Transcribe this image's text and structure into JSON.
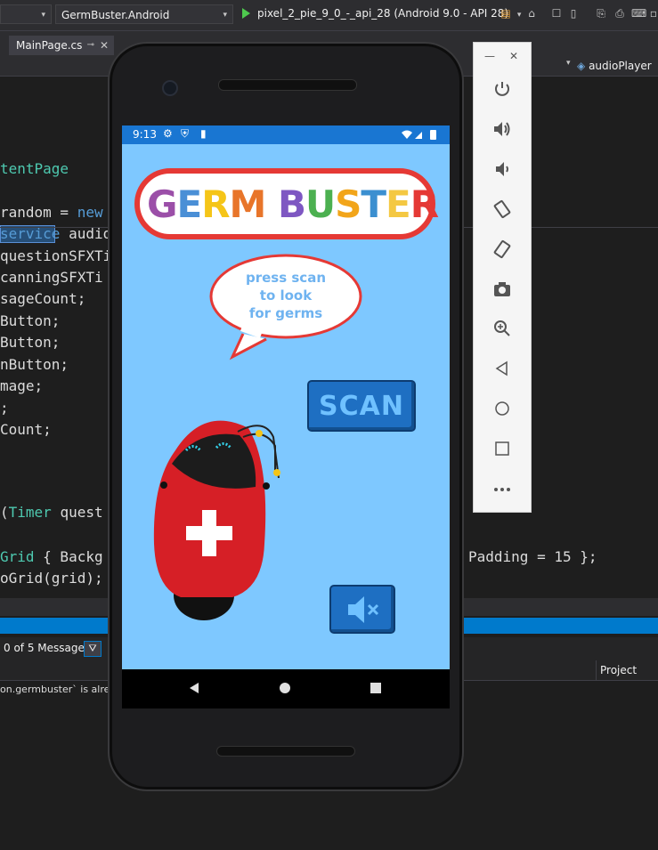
{
  "toolbar": {
    "config_arrow": "▾",
    "project_combo": "GermBuster.Android",
    "run_target": "pixel_2_pie_9_0_-_api_28 (Android 9.0 - API 28)",
    "run_arrow": "▾"
  },
  "editor": {
    "tab_label": "MainPage.cs",
    "tab_pin": "⊸",
    "tab_close": "✕",
    "member_combo": "audioPlayer",
    "code_lines": [
      {
        "parts": [
          [
            "t",
            "tentPage"
          ]
        ]
      },
      {
        "parts": [
          [
            "",
            "random = "
          ],
          [
            "kw",
            "new"
          ]
        ]
      },
      {
        "parts": [
          [
            "kw",
            "service"
          ],
          [
            "",
            " audio"
          ]
        ]
      },
      {
        "parts": [
          [
            "",
            "questionSFXTi"
          ]
        ]
      },
      {
        "parts": [
          [
            "",
            "canningSFXTi"
          ]
        ]
      },
      {
        "parts": [
          [
            "",
            "sageCount;"
          ]
        ]
      },
      {
        "parts": [
          [
            "",
            "Button;"
          ]
        ]
      },
      {
        "parts": [
          [
            "",
            "Button;"
          ]
        ]
      },
      {
        "parts": [
          [
            "",
            "nButton;"
          ]
        ]
      },
      {
        "parts": [
          [
            "",
            "mage;"
          ]
        ]
      },
      {
        "parts": [
          [
            "",
            ";"
          ]
        ]
      },
      {
        "parts": [
          [
            "",
            "Count;"
          ]
        ]
      },
      {
        "parts": [
          [
            "",
            "("
          ],
          [
            "t",
            "Timer"
          ],
          [
            "",
            " quest"
          ]
        ]
      },
      {
        "parts": [
          [
            "t",
            "Grid"
          ],
          [
            "",
            " { Backg"
          ]
        ]
      },
      {
        "parts": [
          [
            "",
            "oGrid(grid);"
          ]
        ]
      }
    ],
    "padding_text": "Padding = 15 };"
  },
  "error_list": {
    "messages_label": "0 of 5 Messages",
    "project_header": "Project",
    "row_text": "on.germbuster` is alrea"
  },
  "app": {
    "status_time": "9:13",
    "title": "GERM BUSTER",
    "title_letters": [
      "G",
      "E",
      "R",
      "M",
      " ",
      "B",
      "U",
      "S",
      "T",
      "E",
      "R"
    ],
    "title_colors": [
      "#9b4fa8",
      "#4a8fd6",
      "#f5c518",
      "#e8752a",
      "",
      "#7e57c2",
      "#4cb050",
      "#f2a51a",
      "#3b8fd0",
      "#f4c842",
      "#e53935"
    ],
    "bubble_text": [
      "press scan",
      "to look",
      "for germs"
    ],
    "scan_label": "SCAN",
    "mute_label": "🔈✕"
  },
  "emulator": {
    "minimize": "—",
    "close": "✕",
    "buttons": [
      "power-icon",
      "volume-up-icon",
      "volume-down-icon",
      "rotate-left-icon",
      "rotate-right-icon",
      "camera-icon",
      "zoom-icon",
      "back-icon",
      "home-icon",
      "overview-icon",
      "more-icon"
    ]
  },
  "colors": {
    "vs_bg": "#1e1e1e",
    "accent": "#007acc",
    "screen_bg": "#7ec8ff",
    "statusbar": "#1976d2",
    "robot_red": "#d61f26"
  }
}
